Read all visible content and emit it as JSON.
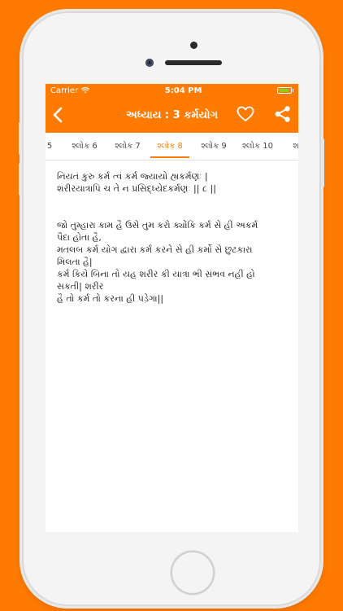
{
  "status": {
    "carrier": "Carrier",
    "time": "5:04 PM",
    "battery_level": 0.85
  },
  "nav": {
    "title": "અધ્યાય : 3 કર્મયોગ"
  },
  "tabs": [
    {
      "label": "5"
    },
    {
      "label": "શ્લોક 6"
    },
    {
      "label": "શ્લોક 7"
    },
    {
      "label": "શ્લોક 8"
    },
    {
      "label": "શ્લોક 9"
    },
    {
      "label": "શ્લોક 10"
    },
    {
      "label": "શ"
    }
  ],
  "active_tab": 3,
  "verse": {
    "sanskrit_lines": [
      "નિયતં કુરુ કર્મ ત્વં કર્મ જ્યાયો હ્યકર્મણઃ |",
      "શરીરયાત્રાપિ ચ તે ન પ્રસિદ્ધ્યેદકર્મણઃ || ૮ ||"
    ],
    "meaning_lines": [
      "જો તુમ્હારા કામ હૈ ઉસે તુમ કરો ક્યોંકિ કર્મ સે હી અકર્મ",
      "પૈદા હોતા હૈ,",
      "મતલબ કર્મ યોગ દ્વારા કર્મ કરને સે હી કર્મો સે છુટકારા",
      "મિલતા હૈ|",
      "કર્મ કિયે બિના તો યહ શરીર કી યાત્રા ભી સંભવ નહીં હો",
      "સકતી| શરીર",
      "હૈ તો કર્મ તો કરના હી પડ઼ેગા||"
    ]
  },
  "colors": {
    "accent": "#ff7a00",
    "background": "#ff7a00"
  },
  "icons": {
    "back": "chevron-left-icon",
    "favorite": "heart-icon",
    "share": "share-icon",
    "wifi": "wifi-icon",
    "battery": "battery-icon"
  }
}
